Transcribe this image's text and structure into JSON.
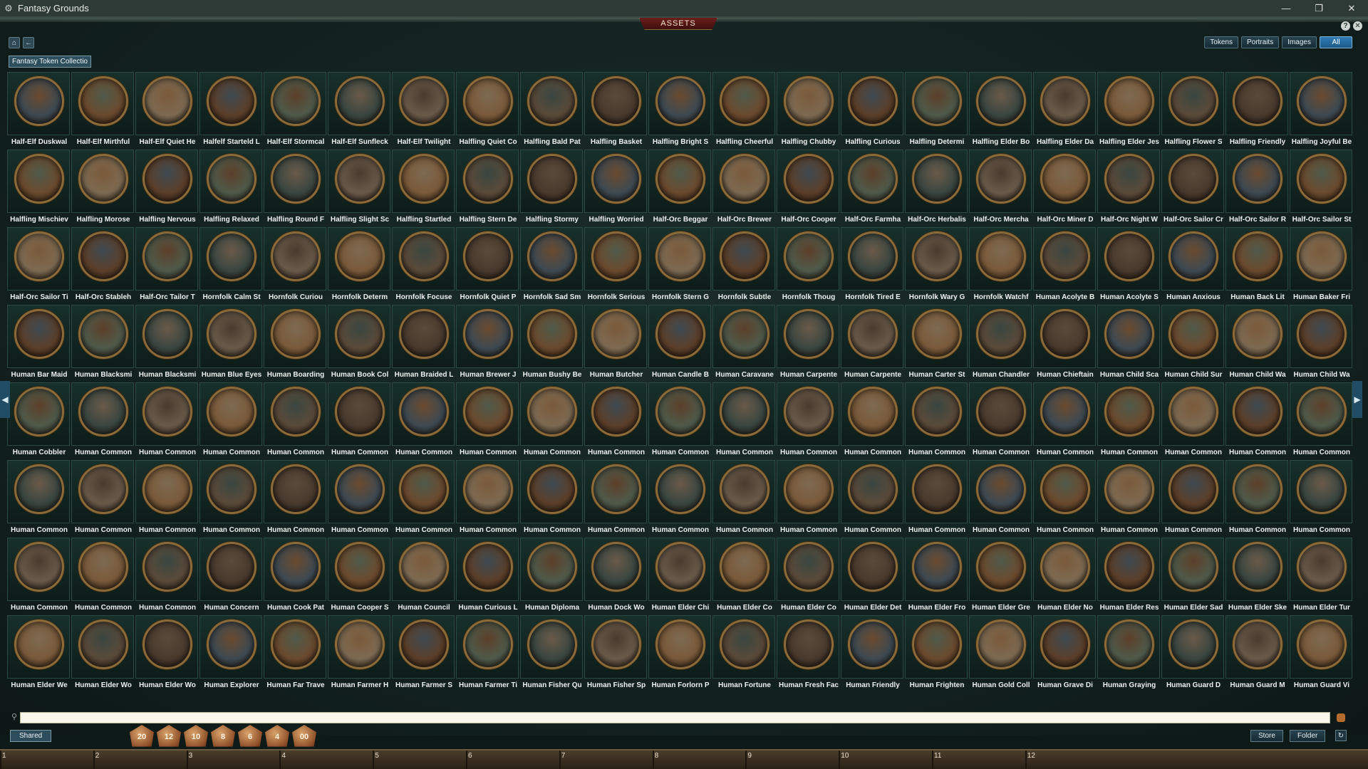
{
  "window": {
    "title": "Fantasy Grounds",
    "icon": "gear-icon"
  },
  "panel": {
    "title": "ASSETS"
  },
  "filters": [
    {
      "label": "Tokens",
      "active": false
    },
    {
      "label": "Portraits",
      "active": false
    },
    {
      "label": "Images",
      "active": false
    },
    {
      "label": "All",
      "active": true
    }
  ],
  "collection": "Fantasy Token Collectio",
  "tokens": [
    "Half-Elf Duskwal",
    "Half-Elf Mirthful",
    "Half-Elf Quiet He",
    "Halfelf Starteld L",
    "Half-Elf Stormcal",
    "Half-Elf Sunfleck",
    "Half-Elf Twilight",
    "Halfling Quiet Co",
    "Halfling Bald Pat",
    "Halfling Basket",
    "Halfling Bright S",
    "Halfling Cheerful",
    "Halfling Chubby",
    "Halfling Curious",
    "Halfling Determi",
    "Halfling Elder Bo",
    "Halfling Elder Da",
    "Halfling Elder Jes",
    "Halfling Flower S",
    "Halfling Friendly",
    "Halfling Joyful Be",
    "Halfling Mischiev",
    "Halfling Morose",
    "Halfling Nervous",
    "Halfling Relaxed",
    "Halfling Round F",
    "Halfling Slight Sc",
    "Halfling Startled",
    "Halfling Stern De",
    "Halfling Stormy",
    "Halfling Worried",
    "Half-Orc Beggar",
    "Half-Orc Brewer",
    "Half-Orc Cooper",
    "Half-Orc Farmha",
    "Half-Orc Herbalis",
    "Half-Orc Mercha",
    "Half-Orc Miner D",
    "Half-Orc Night W",
    "Half-Orc Sailor Cr",
    "Half-Orc Sailor R",
    "Half-Orc Sailor St",
    "Half-Orc Sailor Ti",
    "Half-Orc Stableh",
    "Half-Orc Tailor T",
    "Hornfolk Calm St",
    "Hornfolk Curiou",
    "Hornfolk Determ",
    "Hornfolk Focuse",
    "Hornfolk Quiet P",
    "Hornfolk Sad Sm",
    "Hornfolk Serious",
    "Hornfolk Stern G",
    "Hornfolk Subtle",
    "Hornfolk Thoug",
    "Hornfolk Tired E",
    "Hornfolk Wary G",
    "Hornfolk Watchf",
    "Human Acolyte B",
    "Human Acolyte S",
    "Human Anxious",
    "Human Back Lit",
    "Human Baker Fri",
    "Human Bar Maid",
    "Human Blacksmi",
    "Human Blacksmi",
    "Human Blue Eyes",
    "Human Boarding",
    "Human Book Col",
    "Human Braided L",
    "Human Brewer J",
    "Human Bushy Be",
    "Human Butcher",
    "Human Candle B",
    "Human Caravane",
    "Human Carpente",
    "Human Carpente",
    "Human Carter St",
    "Human Chandler",
    "Human Chieftain",
    "Human Child Sca",
    "Human Child Sur",
    "Human Child Wa",
    "Human Child Wa",
    "Human Cobbler",
    "Human Common",
    "Human Common",
    "Human Common",
    "Human Common",
    "Human Common",
    "Human Common",
    "Human Common",
    "Human Common",
    "Human Common",
    "Human Common",
    "Human Common",
    "Human Common",
    "Human Common",
    "Human Common",
    "Human Common",
    "Human Common",
    "Human Common",
    "Human Common",
    "Human Common",
    "Human Common",
    "Human Common",
    "Human Common",
    "Human Common",
    "Human Common",
    "Human Common",
    "Human Common",
    "Human Common",
    "Human Common",
    "Human Common",
    "Human Common",
    "Human Common",
    "Human Common",
    "Human Common",
    "Human Common",
    "Human Common",
    "Human Common",
    "Human Common",
    "Human Common",
    "Human Common",
    "Human Common",
    "Human Common",
    "Human Common",
    "Human Common",
    "Human Common",
    "Human Concern",
    "Human Cook Pat",
    "Human Cooper S",
    "Human Council",
    "Human Curious L",
    "Human Diploma",
    "Human Dock Wo",
    "Human Elder Chi",
    "Human Elder Co",
    "Human Elder Co",
    "Human Elder Det",
    "Human Elder Fro",
    "Human Elder Gre",
    "Human Elder No",
    "Human Elder Res",
    "Human Elder Sad",
    "Human Elder Ske",
    "Human Elder Tur",
    "Human Elder We",
    "Human Elder Wo",
    "Human Elder Wo",
    "Human Explorer",
    "Human Far Trave",
    "Human Farmer H",
    "Human Farmer S",
    "Human Farmer Ti",
    "Human Fisher Qu",
    "Human Fisher Sp",
    "Human Forlorn P",
    "Human Fortune",
    "Human Fresh Fac",
    "Human Friendly",
    "Human Frighten",
    "Human Gold Coll",
    "Human Grave Di",
    "Human Graying",
    "Human Guard D",
    "Human Guard M",
    "Human Guard Vi"
  ],
  "shared_label": "Shared",
  "dice": [
    "20",
    "12",
    "10",
    "8",
    "6",
    "4",
    "00"
  ],
  "store_label": "Store",
  "folder_label": "Folder",
  "hotkeys": [
    "1",
    "2",
    "3",
    "4",
    "5",
    "6",
    "7",
    "8",
    "9",
    "10",
    "11",
    "12"
  ]
}
